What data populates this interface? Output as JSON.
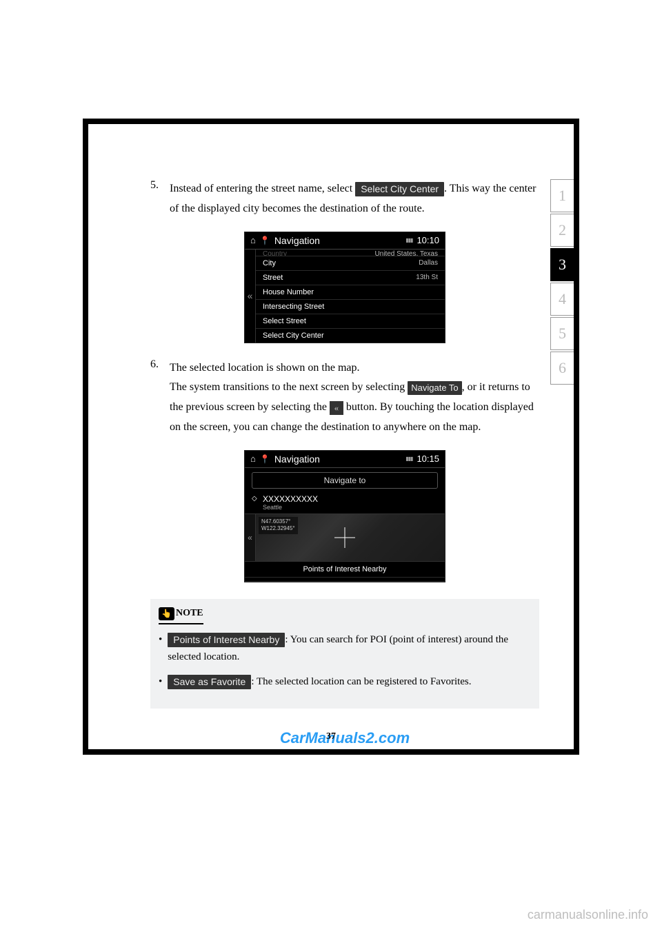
{
  "step5": {
    "num": "5.",
    "text_a": "Instead of entering the street name, select ",
    "btn": "Select City Center",
    "text_b": ". This way the center of the displayed city becomes the destination of the route."
  },
  "screenshot1": {
    "title": "Navigation",
    "time": "10:10",
    "rows": [
      {
        "label": "Country",
        "value": "United States, Texas",
        "dim": true
      },
      {
        "label": "City",
        "value": "Dallas"
      },
      {
        "label": "Street",
        "value": "13th St"
      },
      {
        "label": "House Number",
        "value": ""
      },
      {
        "label": "Intersecting Street",
        "value": ""
      },
      {
        "label": "Select Street",
        "value": ""
      },
      {
        "label": "Select City Center",
        "value": ""
      }
    ]
  },
  "step6": {
    "num": "6.",
    "line1": "The selected location is shown on the map.",
    "line2a": "The system transitions to the next screen by selecting ",
    "btn_nav": "Navigate To",
    "line2b": ", or it returns to the previous screen by selecting the ",
    "line2c": " button. By touching the location displayed on the screen, you can change the destination to anywhere on the map."
  },
  "screenshot2": {
    "title": "Navigation",
    "time": "10:15",
    "nav_to": "Navigate to",
    "loc_name": "XXXXXXXXXX",
    "loc_sub": "Seattle",
    "coords_lat": "N47.60357°",
    "coords_lon": "W122.32945°",
    "poi": "Points of Interest Nearby"
  },
  "note": {
    "title": "NOTE",
    "item1_btn": "Points of Interest Nearby",
    "item1_text": ": You can search for POI (point of interest) around the selected location.",
    "item2_btn": "Save as Favorite",
    "item2_text": ": The selected location can be registered to Favorites."
  },
  "watermark": "CarManuals2.com",
  "page_num": "37",
  "tabs": [
    "1",
    "2",
    "3",
    "4",
    "5",
    "6"
  ],
  "footer_brand": "carmanualsonline.info"
}
